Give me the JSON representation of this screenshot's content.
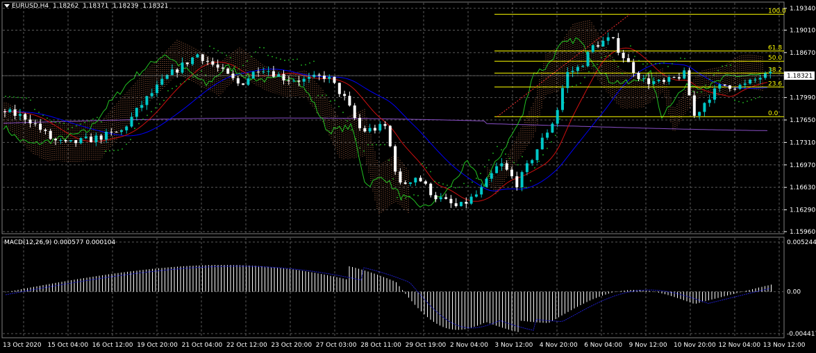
{
  "header": {
    "symbol": "EURUSD,H4",
    "open": "1.18262",
    "high": "1.18371",
    "low": "1.18239",
    "close": "1.18321"
  },
  "macd_header": {
    "name": "MACD(12,26,9)",
    "main": "0.000577",
    "signal": "0.000104"
  },
  "price_axis": {
    "ticks": [
      "1.19340",
      "1.19010",
      "1.18670",
      "1.17990",
      "1.17650",
      "1.17310",
      "1.16970",
      "1.16630",
      "1.16290",
      "1.15960"
    ],
    "current_price": "1.18321"
  },
  "macd_axis": {
    "ticks": [
      "0.005244",
      "0.00",
      "-0.004417"
    ]
  },
  "fib_levels": [
    "100.0",
    "61.8",
    "50.0",
    "38.2",
    "23.6",
    "0.0"
  ],
  "time_axis": {
    "labels": [
      "13 Oct 2020",
      "15 Oct 04:00",
      "16 Oct 12:00",
      "19 Oct 20:00",
      "21 Oct 04:00",
      "22 Oct 12:00",
      "23 Oct 20:00",
      "27 Oct 03:00",
      "28 Oct 11:00",
      "29 Oct 19:00",
      "2 Nov 04:00",
      "3 Nov 12:00",
      "4 Nov 20:00",
      "6 Nov 04:00",
      "9 Nov 12:00",
      "10 Nov 20:00",
      "12 Nov 04:00",
      "13 Nov 12:00"
    ]
  },
  "colors": {
    "background": "#000000",
    "grid": "#5a5a5a",
    "bull": "#00c8c8",
    "bear": "#ffffff",
    "fib": "#ffff00",
    "macd_signal": "#1e1ec8",
    "chikou": "#22c322",
    "kijun": "#d01010",
    "tenkan": "#0000ff",
    "psar": "#22c322",
    "ichimoku_cloud": "#c87850",
    "ma_long": "#8a50c8"
  }
}
